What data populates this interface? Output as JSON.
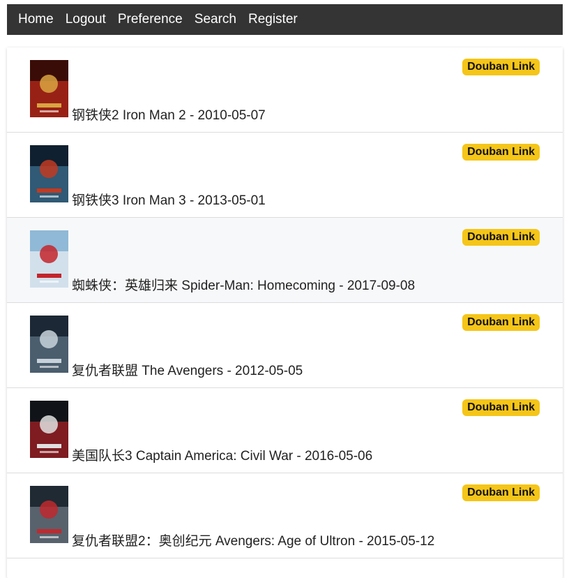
{
  "nav": {
    "items": [
      {
        "label": "Home"
      },
      {
        "label": "Logout"
      },
      {
        "label": "Preference"
      },
      {
        "label": "Search"
      },
      {
        "label": "Register"
      }
    ]
  },
  "movies": [
    {
      "title": "钢铁侠2 Iron Man 2 - 2010-05-07",
      "link_label": "Douban Link",
      "poster": "iron-man-2-poster",
      "palette": [
        "#3a0c08",
        "#b8281a",
        "#d9a441"
      ]
    },
    {
      "title": "钢铁侠3 Iron Man 3 - 2013-05-01",
      "link_label": "Douban Link",
      "poster": "iron-man-3-poster",
      "palette": [
        "#0f2030",
        "#3c6e8c",
        "#c23a22"
      ]
    },
    {
      "title": "蜘蛛侠：英雄归来 Spider-Man: Homecoming - 2017-09-08",
      "link_label": "Douban Link",
      "poster": "spider-man-homecoming-poster",
      "palette": [
        "#8fb9d6",
        "#e8eef3",
        "#c4242b"
      ]
    },
    {
      "title": "复仇者联盟 The Avengers - 2012-05-05",
      "link_label": "Douban Link",
      "poster": "the-avengers-poster",
      "palette": [
        "#1c2836",
        "#5b7082",
        "#c8d2da"
      ]
    },
    {
      "title": "美国队长3 Captain America: Civil War - 2016-05-06",
      "link_label": "Douban Link",
      "poster": "captain-america-civil-war-poster",
      "palette": [
        "#101418",
        "#a31f24",
        "#e0e0e0"
      ]
    },
    {
      "title": "复仇者联盟2：奥创纪元 Avengers: Age of Ultron - 2015-05-12",
      "link_label": "Douban Link",
      "poster": "avengers-age-of-ultron-poster",
      "palette": [
        "#202a33",
        "#6a7682",
        "#c0292e"
      ]
    }
  ]
}
